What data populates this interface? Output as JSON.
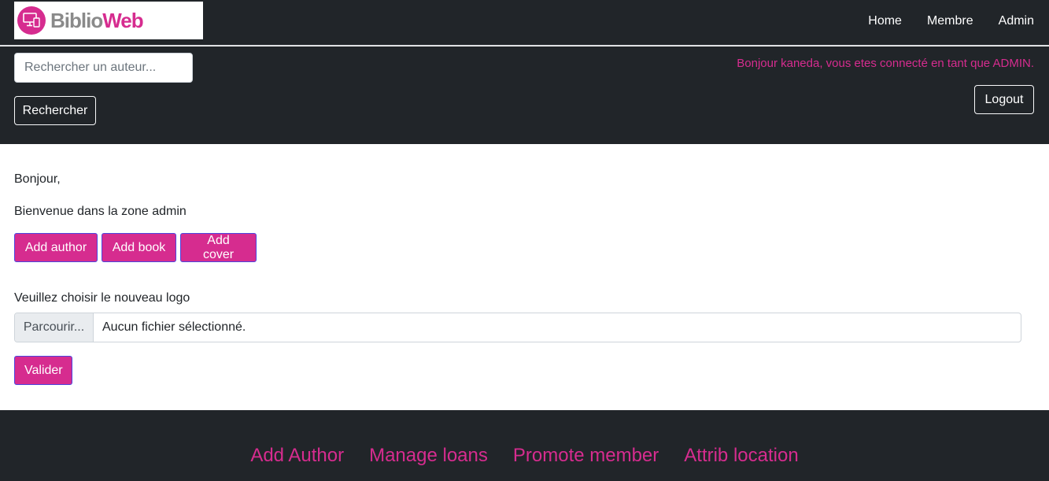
{
  "header": {
    "logo_text_part1": "Biblio",
    "logo_text_part2": "Web",
    "nav": [
      {
        "label": "Home"
      },
      {
        "label": "Membre"
      },
      {
        "label": "Admin"
      }
    ]
  },
  "search": {
    "placeholder": "Rechercher un auteur...",
    "button_label": "Rechercher"
  },
  "user": {
    "greeting": "Bonjour kaneda, vous etes connecté en tant que ADMIN.",
    "logout_label": "Logout"
  },
  "main": {
    "hello": "Bonjour,",
    "welcome": "Bienvenue dans la zone admin",
    "actions": [
      {
        "label": "Add author"
      },
      {
        "label": "Add book"
      },
      {
        "label": "Add cover"
      }
    ],
    "logo_prompt": "Veuillez choisir le nouveau logo",
    "file_browse_label": "Parcourir...",
    "file_status": "Aucun fichier sélectionné.",
    "submit_label": "Valider"
  },
  "footer": {
    "links": [
      {
        "label": "Add Author"
      },
      {
        "label": "Manage loans"
      },
      {
        "label": "Promote member"
      },
      {
        "label": "Attrib location"
      }
    ]
  },
  "colors": {
    "accent": "#d62c8f",
    "dark": "#212529"
  }
}
